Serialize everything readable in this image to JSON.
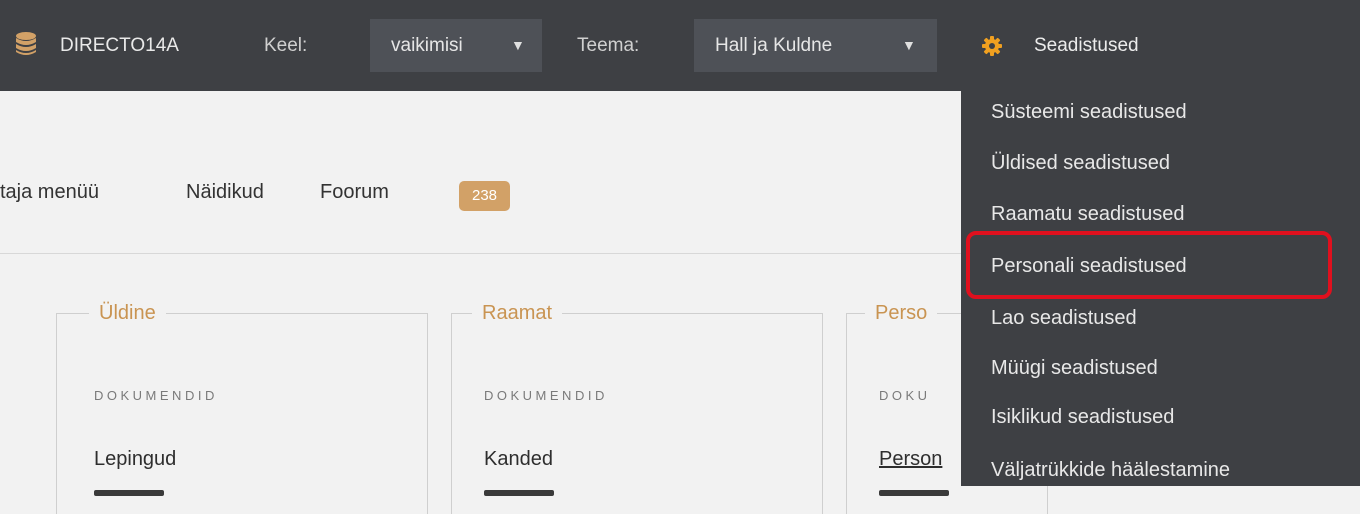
{
  "topbar": {
    "db_name": "DIRECTO14A",
    "lang_label": "Keel:",
    "lang_value": "vaikimisi",
    "theme_label": "Teema:",
    "theme_value": "Hall ja Kuldne",
    "settings_label": "Seadistused",
    "colors": {
      "background": "#3e4044",
      "select_bg": "#4e5157",
      "db_icon": "#d2a167",
      "gear": "#f0a020"
    }
  },
  "nav": {
    "items": [
      "taja menüü",
      "Näidikud",
      "Foorum"
    ],
    "forum_badge": "238",
    "badge_color": "#d2a167"
  },
  "panels": [
    {
      "title": "Üldine",
      "caption": "DOKUMENDID",
      "first_item": "Lepingud"
    },
    {
      "title": "Raamat",
      "caption": "DOKUMENDID",
      "first_item": "Kanded"
    },
    {
      "title": "Perso",
      "caption": "DOKU",
      "first_item": "Person"
    }
  ],
  "settings_menu": {
    "items": [
      "Süsteemi seadistused",
      "Üldised seadistused",
      "Raamatu seadistused",
      "Personali seadistused",
      "Lao seadistused",
      "Müügi seadistused",
      "Isiklikud seadistused",
      "Väljatrükkide häälestamine"
    ],
    "highlighted": "Personali seadistused",
    "highlight_color": "#e0101e"
  }
}
